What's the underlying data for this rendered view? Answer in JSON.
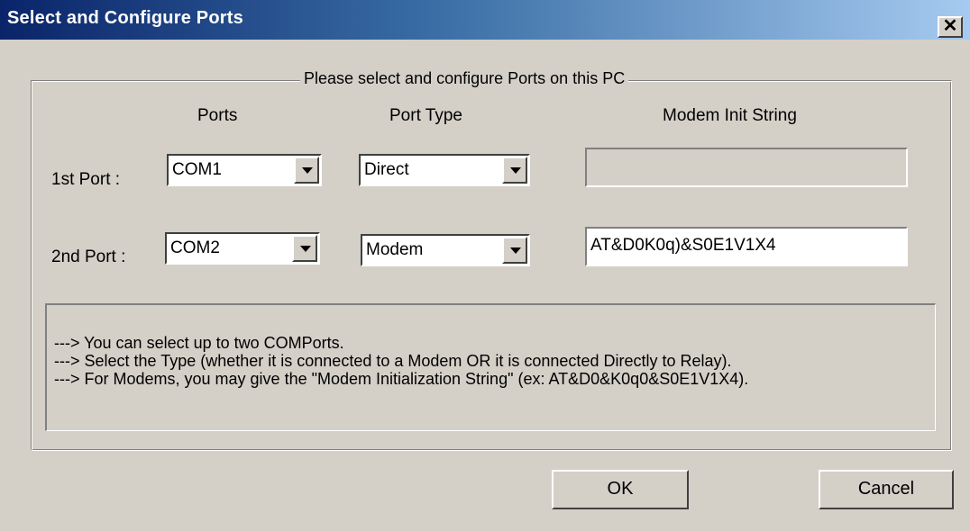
{
  "window": {
    "title": "Select and Configure Ports",
    "close_glyph": "✕"
  },
  "group": {
    "legend": "Please select and configure Ports on this PC"
  },
  "columns": {
    "ports": "Ports",
    "port_type": "Port Type",
    "modem_init": "Modem Init String"
  },
  "rows": [
    {
      "label": "1st Port :",
      "port": "COM1",
      "type": "Direct",
      "init_string": "",
      "init_enabled": false
    },
    {
      "label": "2nd Port :",
      "port": "COM2",
      "type": "Modem",
      "init_string": "AT&D0K0q)&S0E1V1X4",
      "init_enabled": true
    }
  ],
  "info": {
    "lines": [
      "---> You can select up to two COMPorts.",
      "---> Select the Type (whether it is connected to a Modem OR it is connected Directly to Relay).",
      "---> For Modems, you may give the \"Modem Initialization String\" (ex: AT&D0&K0q0&S0E1V1X4)."
    ]
  },
  "buttons": {
    "ok": "OK",
    "cancel": "Cancel"
  },
  "icons": {
    "close": "close-icon",
    "dropdown": "chevron-down-icon"
  },
  "colors": {
    "dialog_bg": "#d4d0c8",
    "title_start": "#0a246a",
    "title_end": "#a6caf0",
    "title_text": "#ffffff"
  }
}
